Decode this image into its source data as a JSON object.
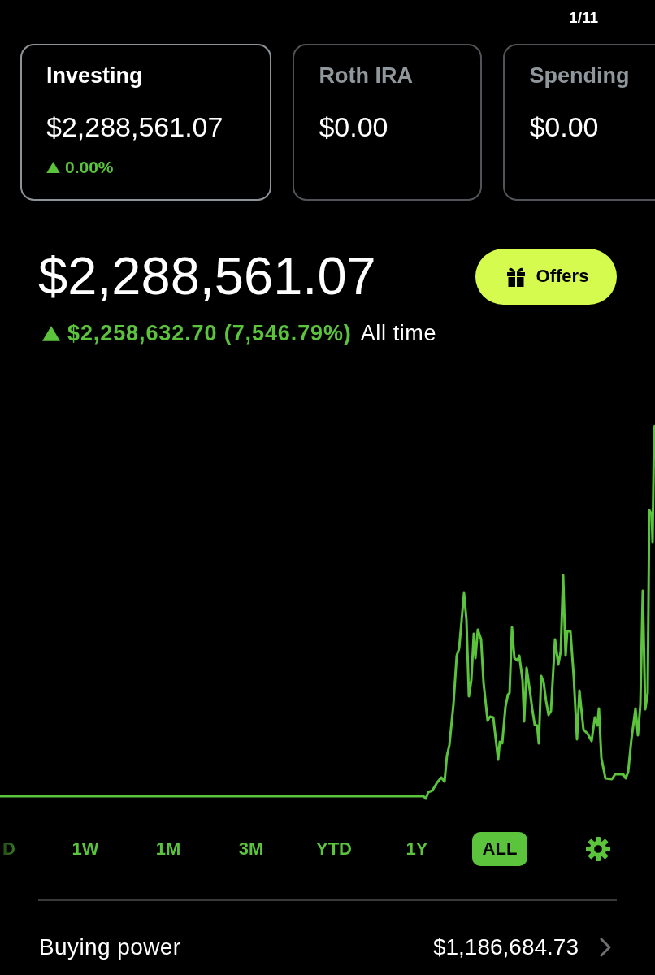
{
  "page_counter": "1/11",
  "accounts": [
    {
      "name": "Investing",
      "value": "$2,288,561.07",
      "change": "0.00%",
      "rising": true,
      "selected": true
    },
    {
      "name": "Roth IRA",
      "value": "$0.00",
      "selected": false
    },
    {
      "name": "Spending",
      "value": "$0.00",
      "selected": false
    }
  ],
  "portfolio": {
    "value": "$2,288,561.07",
    "change": "$2,258,632.70 (7,546.79%)",
    "rising": true,
    "period": "All time"
  },
  "offers_button": {
    "label": "Offers"
  },
  "ranges": [
    {
      "label": "D",
      "selected": false
    },
    {
      "label": "1W",
      "selected": false
    },
    {
      "label": "1M",
      "selected": false
    },
    {
      "label": "3M",
      "selected": false
    },
    {
      "label": "YTD",
      "selected": false
    },
    {
      "label": "1Y",
      "selected": false
    },
    {
      "label": "ALL",
      "selected": true
    }
  ],
  "buying_power": {
    "label": "Buying power",
    "value": "$1,186,684.73"
  }
}
